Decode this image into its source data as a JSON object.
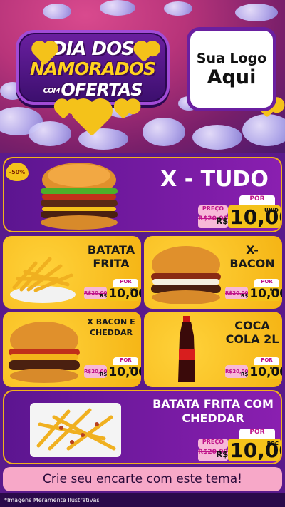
{
  "hero": {
    "title_line1": "DIA DOS",
    "title_line2": "NAMORADOS",
    "title_com": "COM",
    "title_line3": "OFERTAS",
    "logo_line1": "Sua Logo",
    "logo_line2": "Aqui"
  },
  "discount_badge": "-50%",
  "products": [
    {
      "name": "X - TUDO",
      "por": "POR",
      "preco": "PREÇO",
      "old_price": "R$20,00",
      "currency": "R$",
      "price": "10,00",
      "unit": "UNID"
    },
    {
      "name_line1": "BATATA",
      "name_line2": "FRITA",
      "por": "POR",
      "old_price": "R$20,00",
      "currency": "R$",
      "price": "10,00",
      "unit": "POC"
    },
    {
      "name_line1": "X-",
      "name_line2": "BACON",
      "por": "POR",
      "old_price": "R$20,00",
      "currency": "R$",
      "price": "10,00",
      "unit": "UNID"
    },
    {
      "name_line1": "X BACON E",
      "name_line2": "CHEDDAR",
      "por": "POR",
      "old_price": "R$20,00",
      "currency": "R$",
      "price": "10,00",
      "unit": "UNID"
    },
    {
      "name_line1": "COCA",
      "name_line2": "COLA 2L",
      "por": "POR",
      "old_price": "R$20,00",
      "currency": "R$",
      "price": "10,00",
      "unit": "UNID"
    },
    {
      "name_line1": "BATATA FRITA COM",
      "name_line2": "CHEDDAR",
      "por": "POR",
      "preco": "PREÇO",
      "old_price": "R$20,00",
      "currency": "R$",
      "price": "10,00",
      "unit": "POC"
    }
  ],
  "cta": "Crie seu encarte com este tema!",
  "disclaimer": "*Imagens Meramente Ilustrativas",
  "colors": {
    "purple": "#5c1590",
    "yellow": "#f5b414",
    "pink": "#c0148a",
    "cta_bg": "#f7a8c8"
  }
}
